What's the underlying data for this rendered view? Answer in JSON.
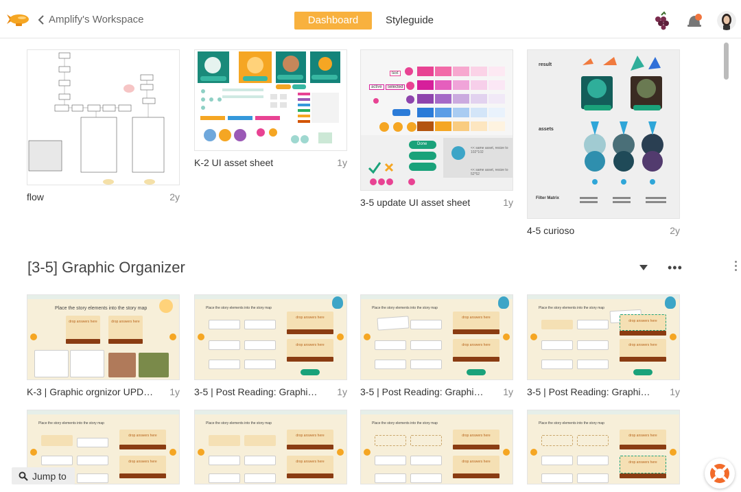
{
  "header": {
    "back_label": "Amplify's Workspace",
    "tabs": [
      "Dashboard",
      "Styleguide"
    ],
    "active_tab": "Dashboard",
    "accent": "#f8b13e"
  },
  "cards_row1": [
    {
      "name": "flow",
      "age": "2y"
    },
    {
      "name": "K-2 UI asset sheet",
      "age": "1y"
    },
    {
      "name": "3-5 update UI asset sheet",
      "age": "1y"
    },
    {
      "name": "4-5 curioso",
      "age": "2y"
    }
  ],
  "thumb_text": {
    "asset_k2": {
      "try_again": "Try Again",
      "continue": "Continue",
      "next": "Next",
      "start": "Start",
      "back": "Back"
    },
    "asset_35": {
      "text": "text",
      "active": "active",
      "selected": "selected",
      "done": "Done",
      "same_asset_1": "<< same asset, resize to 102*102",
      "same_asset_2": "<< same asset, resize to 52*52"
    },
    "curioso": {
      "result": "result",
      "assets": "assets",
      "filter_matrix": "Filter Matrix",
      "continue": "Continue",
      "try_again": "Try Again"
    }
  },
  "section": {
    "title": "[3-5] Graphic Organizer"
  },
  "cards_row2": [
    {
      "name": "K-3 | Graphic orgnizor UPDATE",
      "age": "1y"
    },
    {
      "name": "3-5 | Post Reading: Graphic org...",
      "age": "1y"
    },
    {
      "name": "3-5 | Post Reading: Graphic org...",
      "age": "1y"
    },
    {
      "name": "3-5 | Post Reading: Graphic org...",
      "age": "1y"
    }
  ],
  "organizer": {
    "prompt": "Place the story elements into the story map",
    "drop": "drop answers here",
    "characters": "Characters",
    "setting": "Setting",
    "done": "Done",
    "names": [
      "Alexander",
      "James",
      "Betsy",
      "Christopher"
    ],
    "items": [
      "Constitutional Convention",
      "Revolutionary War"
    ]
  },
  "jump_to": "Jump to"
}
